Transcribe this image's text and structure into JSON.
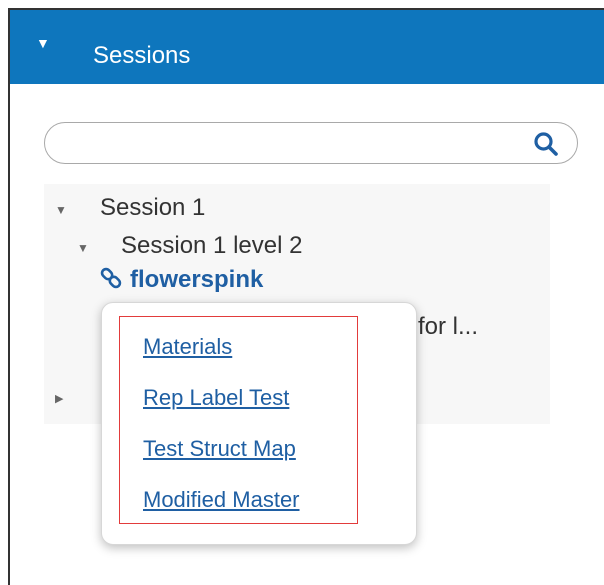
{
  "panel": {
    "title": "Sessions",
    "caret_icon": "caret-down-icon"
  },
  "search": {
    "value": "",
    "placeholder": "",
    "button_icon": "search-icon"
  },
  "tree": {
    "session1": {
      "label": "Session 1",
      "toggle_icon": "caret-down-icon"
    },
    "session1_level2": {
      "label": "Session 1 level 2",
      "toggle_icon": "caret-down-icon"
    },
    "selected_item": {
      "label": "flowerspink",
      "icon": "link-icon"
    },
    "partial_item": {
      "label": "for l..."
    },
    "collapsed_toggle_icon": "caret-right-icon"
  },
  "popup_menu": {
    "items": [
      {
        "label": "Materials"
      },
      {
        "label": "Rep Label Test"
      },
      {
        "label": "Test Struct Map"
      },
      {
        "label": "Modified Master"
      }
    ]
  },
  "colors": {
    "header": "#0e76bd",
    "link": "#1f5fa3",
    "highlight_border": "#e23b3b"
  }
}
